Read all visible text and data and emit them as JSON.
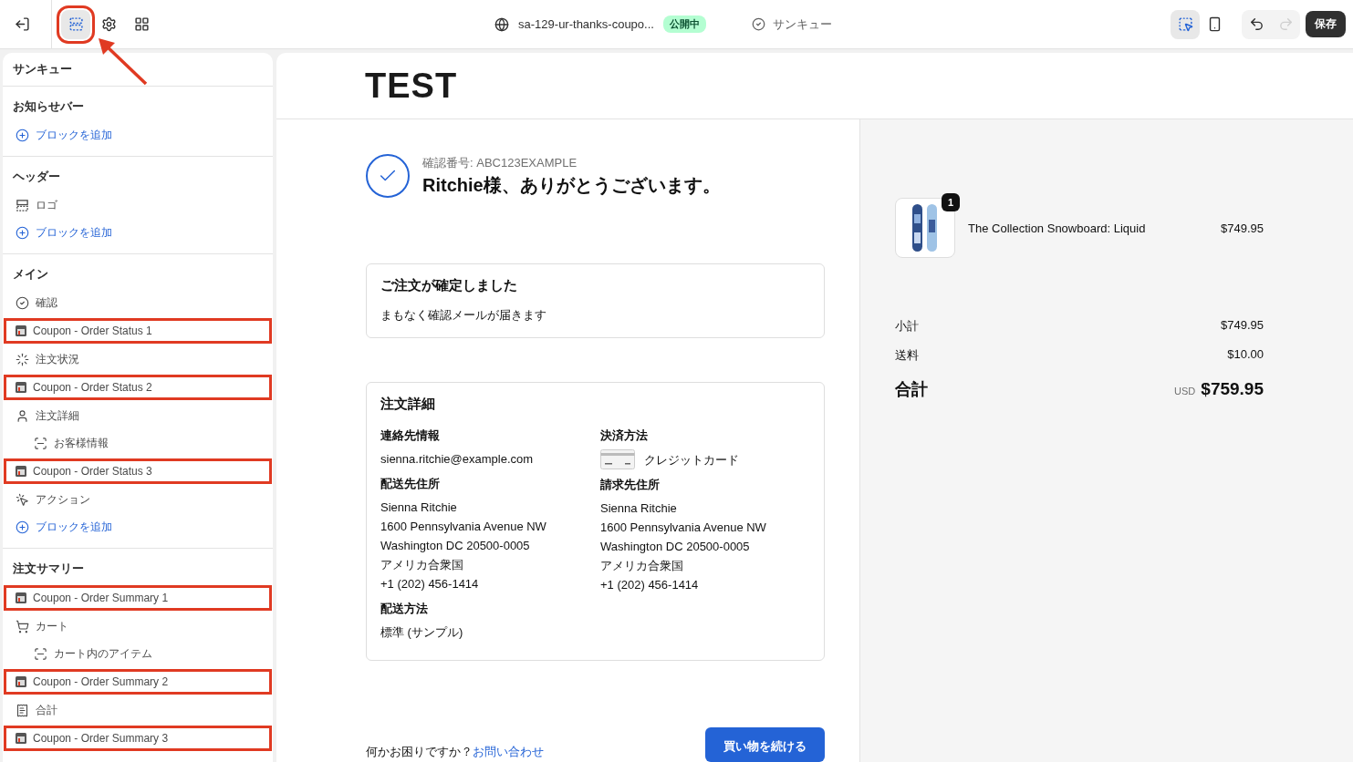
{
  "topbar": {
    "tools": [
      {
        "kind": "exit",
        "selected": false
      },
      {
        "kind": "sections",
        "selected": true,
        "highlighted": true
      },
      {
        "kind": "settings",
        "selected": false
      },
      {
        "kind": "apps",
        "selected": false
      }
    ],
    "page": {
      "title": "sa-129-ur-thanks-coupo...",
      "badge": "公開中",
      "template": "サンキュー"
    },
    "right_tools": [
      {
        "kind": "inspect",
        "selected": true
      },
      {
        "kind": "mobile",
        "selected": false
      },
      {
        "kind": "undo",
        "disabled": false
      },
      {
        "kind": "redo",
        "disabled": true
      }
    ],
    "save": "保存"
  },
  "sidebar": {
    "title": "サンキュー",
    "sections": [
      {
        "heading": "お知らせバー",
        "items": [
          {
            "kind": "add",
            "label": "ブロックを追加"
          }
        ]
      },
      {
        "heading": "ヘッダー",
        "items": [
          {
            "kind": "logo",
            "label": "ロゴ"
          },
          {
            "kind": "add",
            "label": "ブロックを追加"
          }
        ]
      },
      {
        "heading": "メイン",
        "items": [
          {
            "kind": "check",
            "label": "確認"
          },
          {
            "kind": "coupon",
            "label": "Coupon - Order Status 1",
            "highlighted": true
          },
          {
            "kind": "status",
            "label": "注文状況"
          },
          {
            "kind": "coupon",
            "label": "Coupon - Order Status 2",
            "highlighted": true
          },
          {
            "kind": "person",
            "label": "注文詳細",
            "children": [
              {
                "kind": "block",
                "label": "お客様情報"
              }
            ]
          },
          {
            "kind": "coupon",
            "label": "Coupon - Order Status 3",
            "highlighted": true
          },
          {
            "kind": "action",
            "label": "アクション"
          },
          {
            "kind": "add",
            "label": "ブロックを追加"
          }
        ]
      },
      {
        "heading": "注文サマリー",
        "items": [
          {
            "kind": "coupon",
            "label": "Coupon - Order Summary 1",
            "highlighted": true
          },
          {
            "kind": "cart",
            "label": "カート",
            "children": [
              {
                "kind": "block",
                "label": "カート内のアイテム"
              }
            ]
          },
          {
            "kind": "coupon",
            "label": "Coupon - Order Summary 2",
            "highlighted": true
          },
          {
            "kind": "receipt",
            "label": "合計"
          },
          {
            "kind": "coupon",
            "label": "Coupon - Order Summary 3",
            "highlighted": true
          }
        ]
      }
    ]
  },
  "preview": {
    "logo": "TEST",
    "confirmation": {
      "number": "確認番号: ABC123EXAMPLE",
      "greeting": "Ritchie様、ありがとうございます。"
    },
    "status_card": {
      "title": "ご注文が確定しました",
      "text": "まもなく確認メールが届きます"
    },
    "details": {
      "title": "注文詳細",
      "columns": [
        [
          {
            "label": "連絡先情報",
            "lines": [
              "sienna.ritchie@example.com"
            ]
          },
          {
            "label": "配送先住所",
            "lines": [
              "Sienna Ritchie",
              "1600 Pennsylvania Avenue NW",
              "Washington DC 20500-0005",
              "アメリカ合衆国",
              "+1 (202) 456-1414"
            ]
          },
          {
            "label": "配送方法",
            "lines": [
              "標準 (サンプル)"
            ]
          }
        ],
        [
          {
            "label": "決済方法",
            "lines": [
              "クレジットカード"
            ],
            "kind": "card"
          },
          {
            "label": "請求先住所",
            "lines": [
              "Sienna Ritchie",
              "1600 Pennsylvania Avenue NW",
              "Washington DC 20500-0005",
              "アメリカ合衆国",
              "+1 (202) 456-1414"
            ]
          }
        ]
      ]
    },
    "footer": {
      "question": "何かお困りですか？",
      "link": "お問い合わせ",
      "button": "買い物を続ける"
    },
    "summary": {
      "item": {
        "quantity": "1",
        "name": "The Collection Snowboard: Liquid",
        "price": "$749.95"
      },
      "rows": [
        {
          "label": "小計",
          "value": "$749.95"
        },
        {
          "label": "送料",
          "value": "$10.00"
        }
      ],
      "total": {
        "label": "合計",
        "currency": "USD",
        "value": "$759.95"
      }
    }
  }
}
